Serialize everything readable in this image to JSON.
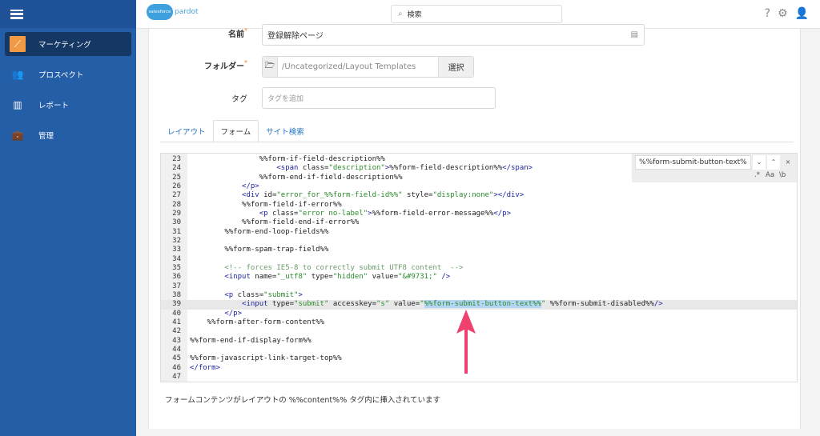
{
  "sidebar": {
    "items": [
      {
        "label": "マーケティング",
        "icon": "magic-wand-icon",
        "active": true
      },
      {
        "label": "プロスペクト",
        "icon": "users-icon"
      },
      {
        "label": "レポート",
        "icon": "chart-icon"
      },
      {
        "label": "管理",
        "icon": "briefcase-icon"
      }
    ]
  },
  "header": {
    "logo_cloud": "salesforce",
    "logo_text": "pardot",
    "search_placeholder": "検索"
  },
  "form": {
    "name_label": "名前",
    "name_value": "登録解除ページ",
    "folder_label": "フォルダー",
    "folder_value": "/Uncategorized/Layout Templates",
    "folder_button": "選択",
    "tag_label": "タグ",
    "tag_placeholder": "タグを追加"
  },
  "tabs": [
    {
      "label": "レイアウト"
    },
    {
      "label": "フォーム",
      "active": true
    },
    {
      "label": "サイト検索"
    }
  ],
  "editor": {
    "find": {
      "query": "%%form-submit-button-text%",
      "regex": ".*",
      "case": "Aa",
      "word": "\\b",
      "close": "×"
    },
    "highlight_line": 39,
    "lines": [
      {
        "n": "23",
        "tokens": [
          [
            "txt",
            "                %%form-if-field-description%%"
          ]
        ]
      },
      {
        "n": "24",
        "tokens": [
          [
            "tag",
            "                    <span "
          ],
          [
            "txt",
            "class="
          ],
          [
            "str",
            "\"description\""
          ],
          [
            "tag",
            ">"
          ],
          [
            "txt",
            "%%form-field-description%%"
          ],
          [
            "tag",
            "</span>"
          ]
        ]
      },
      {
        "n": "25",
        "tokens": [
          [
            "txt",
            "                %%form-end-if-field-description%%"
          ]
        ]
      },
      {
        "n": "26",
        "tokens": [
          [
            "tag",
            "            </p>"
          ]
        ]
      },
      {
        "n": "27",
        "tokens": [
          [
            "tag",
            "            <div "
          ],
          [
            "txt",
            "id="
          ],
          [
            "str",
            "\"error_for_%%form-field-id%%\""
          ],
          [
            "txt",
            " style="
          ],
          [
            "str",
            "\"display:none\""
          ],
          [
            "tag",
            "></div>"
          ]
        ]
      },
      {
        "n": "28",
        "tokens": [
          [
            "txt",
            "            %%form-field-if-error%%"
          ]
        ]
      },
      {
        "n": "29",
        "tokens": [
          [
            "tag",
            "                <p "
          ],
          [
            "txt",
            "class="
          ],
          [
            "str",
            "\"error no-label\""
          ],
          [
            "tag",
            ">"
          ],
          [
            "txt",
            "%%form-field-error-message%%"
          ],
          [
            "tag",
            "</p>"
          ]
        ]
      },
      {
        "n": "30",
        "tokens": [
          [
            "txt",
            "            %%form-field-end-if-error%%"
          ]
        ]
      },
      {
        "n": "31",
        "tokens": [
          [
            "txt",
            "        %%form-end-loop-fields%%"
          ]
        ]
      },
      {
        "n": "32",
        "tokens": []
      },
      {
        "n": "33",
        "tokens": [
          [
            "txt",
            "        %%form-spam-trap-field%%"
          ]
        ]
      },
      {
        "n": "34",
        "tokens": []
      },
      {
        "n": "35",
        "tokens": [
          [
            "com",
            "        <!-- forces IE5-8 to correctly submit UTF8 content  -->"
          ]
        ]
      },
      {
        "n": "36",
        "tokens": [
          [
            "tag",
            "        <input "
          ],
          [
            "txt",
            "name="
          ],
          [
            "str",
            "\"_utf8\""
          ],
          [
            "txt",
            " type="
          ],
          [
            "str",
            "\"hidden\""
          ],
          [
            "txt",
            " value="
          ],
          [
            "str",
            "\"&#9731;\""
          ],
          [
            "tag",
            " />"
          ]
        ]
      },
      {
        "n": "37",
        "tokens": []
      },
      {
        "n": "38",
        "tokens": [
          [
            "tag",
            "        <p "
          ],
          [
            "txt",
            "class="
          ],
          [
            "str",
            "\"submit\""
          ],
          [
            "tag",
            ">"
          ]
        ]
      },
      {
        "n": "39",
        "tokens": [
          [
            "tag",
            "            <input "
          ],
          [
            "txt",
            "type="
          ],
          [
            "str",
            "\"submit\""
          ],
          [
            "txt",
            " accesskey="
          ],
          [
            "str",
            "\"s\""
          ],
          [
            "txt",
            " value="
          ],
          [
            "str",
            "\""
          ],
          [
            "sel",
            "%%form-submit-button-text%%"
          ],
          [
            "str",
            "\""
          ],
          [
            "txt",
            " %%form-submit-disabled%%"
          ],
          [
            "tag",
            "/>"
          ]
        ]
      },
      {
        "n": "40",
        "tokens": [
          [
            "tag",
            "        </p>"
          ]
        ]
      },
      {
        "n": "41",
        "tokens": [
          [
            "txt",
            "    %%form-after-form-content%%"
          ]
        ]
      },
      {
        "n": "42",
        "tokens": []
      },
      {
        "n": "43",
        "tokens": [
          [
            "txt",
            "%%form-end-if-display-form%%"
          ]
        ]
      },
      {
        "n": "44",
        "tokens": []
      },
      {
        "n": "45",
        "tokens": [
          [
            "txt",
            "%%form-javascript-link-target-top%%"
          ]
        ]
      },
      {
        "n": "46",
        "tokens": [
          [
            "tag",
            "</form>"
          ]
        ]
      },
      {
        "n": "47",
        "tokens": []
      }
    ]
  },
  "note": "フォームコンテンツがレイアウトの %%content%% タグ内に挿入されています",
  "colors": {
    "sidebar": "#235ea7",
    "active_nav": "#143763",
    "accent": "#f19a45",
    "annotation_arrow": "#f0406e",
    "link": "#2a76c4"
  }
}
